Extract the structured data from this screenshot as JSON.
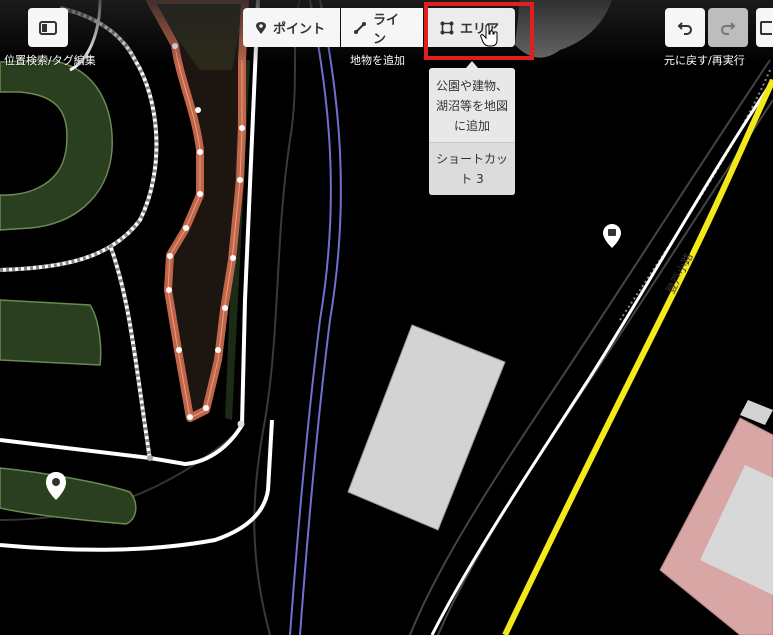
{
  "toolbar": {
    "sidebar_caption": "位置検索/タグ編集",
    "point_label": "ポイント",
    "line_label": "ライン",
    "area_label": "エリア",
    "add_feature_caption": "地物を追加",
    "undo_redo_caption": "元に戻す/再実行"
  },
  "tooltip": {
    "description": "公園や建物、湖沼等を地図に追加",
    "shortcut_label": "ショートカット",
    "shortcut_key": "3"
  },
  "map": {
    "road_label": "登戸小路",
    "colors": {
      "background": "#000000",
      "park": "#2a3f1f",
      "selected_outline": "#c0654a",
      "road_yellow": "#f2e81a",
      "building": "#d3d3d3",
      "building_pink": "#d9a6a6",
      "water_line": "#7070d0",
      "highlight": "#e02020"
    }
  }
}
